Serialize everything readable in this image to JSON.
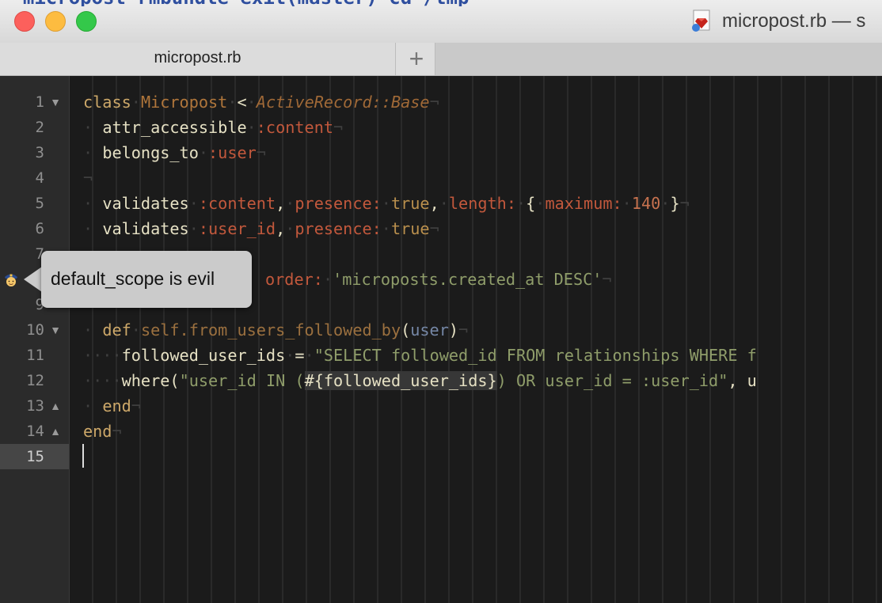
{
  "window": {
    "title": "micropost.rb — s",
    "background_terminal_text": "  micropost-rmbundle exit(master) cd /tmp",
    "icon": "ruby-file-icon"
  },
  "tabs": [
    {
      "label": "micropost.rb",
      "active": true
    }
  ],
  "new_tab": {
    "label": "+"
  },
  "tooltip": {
    "text": "default_scope is evil",
    "icon": "police-officer-icon"
  },
  "editor": {
    "current_line": 15,
    "line_numbers": [
      "1",
      "2",
      "3",
      "4",
      "5",
      "6",
      "7",
      "8",
      "9",
      "10",
      "11",
      "12",
      "13",
      "14",
      "15"
    ],
    "fold_markers": {
      "line1": "▼",
      "line10": "▼",
      "line13": "▲",
      "line14": "▲"
    },
    "code": {
      "l1_class": "class",
      "l1_name": "Micropost",
      "l1_lt": "<",
      "l1_parent": "ActiveRecord::Base",
      "l2_method": "attr_accessible",
      "l2_sym": ":content",
      "l3_method": "belongs_to",
      "l3_sym": ":user",
      "l5_method": "validates",
      "l5_sym": ":content",
      "l5_presence": "presence:",
      "l5_true": "true",
      "l5_length": "length:",
      "l5_open": "{",
      "l5_max": "maximum:",
      "l5_num": "140",
      "l5_close": "}",
      "l6_method": "validates",
      "l6_sym": ":user_id",
      "l6_presence": "presence:",
      "l6_true": "true",
      "l8_order": "order:",
      "l8_str": "'microposts.created_at DESC'",
      "l10_def": "def",
      "l10_name": "self.from_users_followed_by",
      "l10_param": "user",
      "l11_var": "followed_user_ids",
      "l11_eq": "=",
      "l11_str": "\"SELECT followed_id FROM relationships WHERE f",
      "l12_where": "where(",
      "l12_str1": "\"user_id IN (",
      "l12_interp": "#{followed_user_ids}",
      "l12_str2": ") OR user_id = :user_id\"",
      "l12_rest": ", u",
      "l13_end": "end",
      "l14_end": "end"
    }
  }
}
